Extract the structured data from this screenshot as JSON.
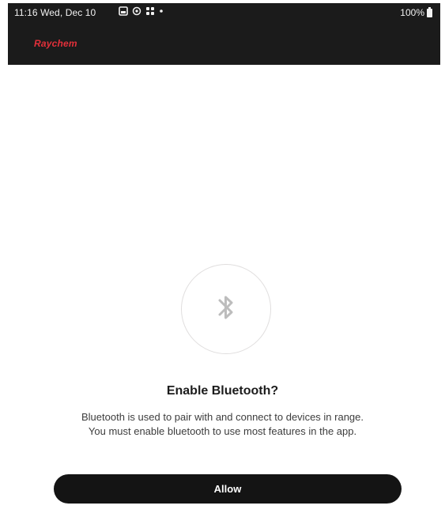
{
  "status_bar": {
    "time_date": "11:16  Wed, Dec 10",
    "battery": "100%",
    "icons": [
      "gallery-icon",
      "sync-icon",
      "apps-grid-icon",
      "notification-dot-icon"
    ]
  },
  "header": {
    "brand": "Raychem",
    "brand_color": "#e3303a"
  },
  "dialog": {
    "icon": "bluetooth-icon",
    "title": "Enable Bluetooth?",
    "body_line1": "Bluetooth is used to pair with and connect to devices in range.",
    "body_line2": "You must enable bluetooth to use most features in the app.",
    "allow_label": "Allow"
  },
  "colors": {
    "header_background": "#1b1b1b",
    "button_background": "#141414"
  }
}
